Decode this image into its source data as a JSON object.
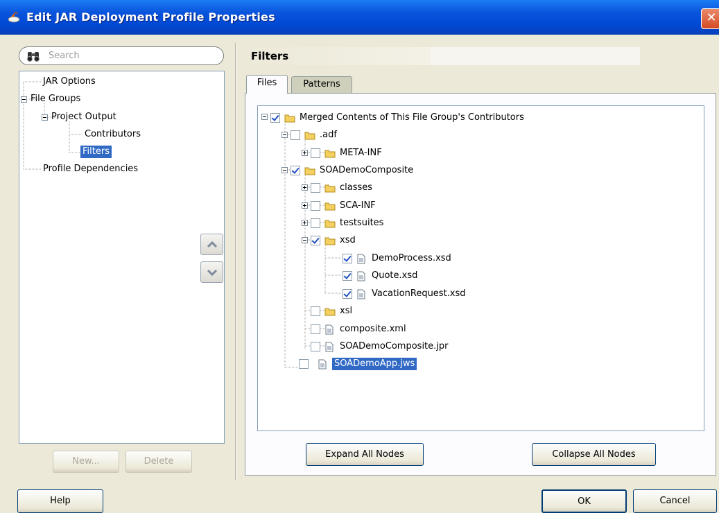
{
  "window": {
    "title": "Edit JAR Deployment Profile Properties",
    "close_label": "✕"
  },
  "search": {
    "placeholder": "Search"
  },
  "nav": {
    "items": [
      {
        "label": "JAR Options"
      },
      {
        "label": "File Groups"
      },
      {
        "label": "Project Output"
      },
      {
        "label": "Contributors"
      },
      {
        "label": "Filters",
        "selected": true
      },
      {
        "label": "Profile Dependencies"
      }
    ],
    "new_label": "New...",
    "delete_label": "Delete"
  },
  "main": {
    "section_title": "Filters",
    "tabs": [
      {
        "label": "Files",
        "active": true
      },
      {
        "label": "Patterns",
        "active": false
      }
    ],
    "tree": [
      {
        "label": "Merged Contents of This File Group's Contributors",
        "type": "folder",
        "checked": true
      },
      {
        "label": ".adf",
        "type": "folder",
        "checked": false
      },
      {
        "label": "META-INF",
        "type": "folder",
        "checked": false
      },
      {
        "label": "SOADemoComposite",
        "type": "folder",
        "checked": true
      },
      {
        "label": "classes",
        "type": "folder",
        "checked": false
      },
      {
        "label": "SCA-INF",
        "type": "folder",
        "checked": false
      },
      {
        "label": "testsuites",
        "type": "folder",
        "checked": false
      },
      {
        "label": "xsd",
        "type": "folder",
        "checked": true
      },
      {
        "label": "DemoProcess.xsd",
        "type": "file",
        "checked": true
      },
      {
        "label": "Quote.xsd",
        "type": "file",
        "checked": true
      },
      {
        "label": "VacationRequest.xsd",
        "type": "file",
        "checked": true
      },
      {
        "label": "xsl",
        "type": "folder",
        "checked": false
      },
      {
        "label": "composite.xml",
        "type": "file",
        "checked": false
      },
      {
        "label": "SOADemoComposite.jpr",
        "type": "file",
        "checked": false
      },
      {
        "label": "SOADemoApp.jws",
        "type": "file",
        "checked": false,
        "selected": true
      }
    ],
    "expand_all_label": "Expand All Nodes",
    "collapse_all_label": "Collapse All Nodes"
  },
  "footer": {
    "help_label": "Help",
    "ok_label": "OK",
    "cancel_label": "Cancel"
  },
  "colors": {
    "selection": "#316ac5",
    "titlebar": "#0a55dd",
    "folder": "#f2c94c"
  }
}
